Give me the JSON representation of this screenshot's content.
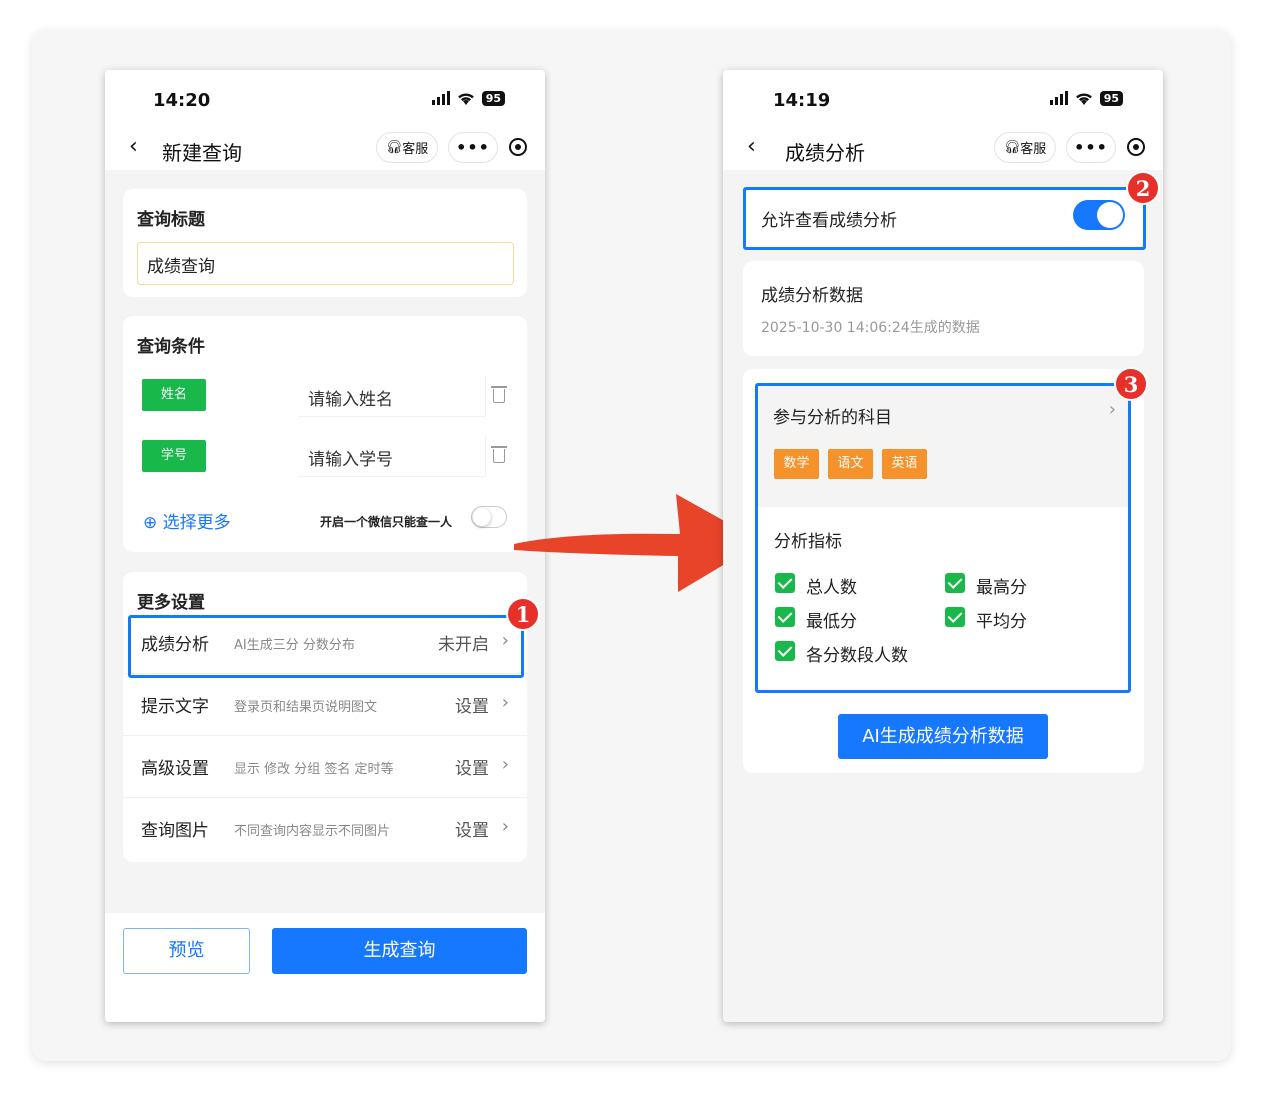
{
  "left": {
    "status": {
      "time": "14:20",
      "battery": "95"
    },
    "nav": {
      "title": "新建查询",
      "kefu": "客服",
      "more": "•••"
    },
    "title_section": {
      "heading": "查询标题",
      "value": "成绩查询"
    },
    "conditions": {
      "heading": "查询条件",
      "items": [
        {
          "tag": "姓名",
          "placeholder": "请输入姓名"
        },
        {
          "tag": "学号",
          "placeholder": "请输入学号"
        }
      ],
      "select_more": "选择更多",
      "one_wechat_label": "开启一个微信只能查一人"
    },
    "settings": {
      "heading": "更多设置",
      "rows": [
        {
          "label": "成绩分析",
          "desc": "AI生成三分 分数分布",
          "value": "未开启"
        },
        {
          "label": "提示文字",
          "desc": "登录页和结果页说明图文",
          "value": "设置"
        },
        {
          "label": "高级设置",
          "desc": "显示 修改 分组 签名 定时等",
          "value": "设置"
        },
        {
          "label": "查询图片",
          "desc": "不同查询内容显示不同图片",
          "value": "设置"
        }
      ]
    },
    "buttons": {
      "preview": "预览",
      "generate": "生成查询"
    }
  },
  "right": {
    "status": {
      "time": "14:19",
      "battery": "95"
    },
    "nav": {
      "title": "成绩分析",
      "kefu": "客服",
      "more": "•••"
    },
    "allow_label": "允许查看成绩分析",
    "allow_enabled": true,
    "data_section": {
      "heading": "成绩分析数据",
      "timestamp": "2025-10-30 14:06:24生成的数据"
    },
    "subjects": {
      "heading": "参与分析的科目",
      "tags": [
        "数学",
        "语文",
        "英语"
      ]
    },
    "metrics": {
      "heading": "分析指标",
      "items": [
        "总人数",
        "最高分",
        "最低分",
        "平均分",
        "各分数段人数"
      ]
    },
    "gen_button": "AI生成成绩分析数据"
  },
  "badges": [
    "1",
    "2",
    "3"
  ],
  "colors": {
    "primary": "#1677ff",
    "green": "#18b84a",
    "orange": "#f5922b",
    "badge_red": "#e8302a",
    "arrow": "#e8442a"
  }
}
